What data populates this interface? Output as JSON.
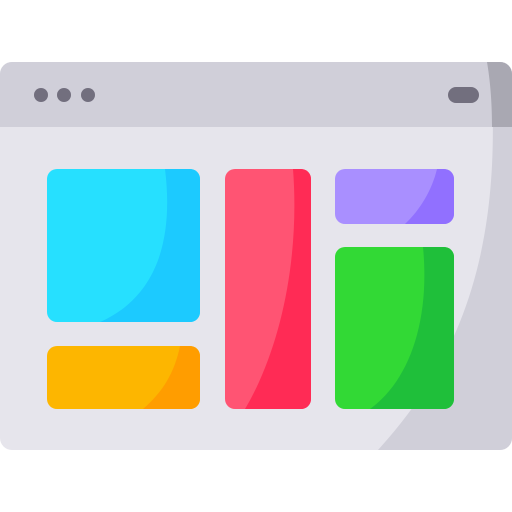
{
  "window": {
    "frame_color": "#e6e5ec",
    "frame_shade_color": "#d0cfd9",
    "titlebar_color": "#d0cfd9",
    "titlebar_shade_color": "#a9a8b2",
    "dot_color": "#726f7e",
    "dots": [
      "dot",
      "dot",
      "dot"
    ],
    "icons": [
      "window-dots-icon",
      "window-pill-icon"
    ]
  },
  "layout_blocks": [
    {
      "name": "cyan-block",
      "color": "#26e0ff",
      "shade": "#1ccaff"
    },
    {
      "name": "orange-block",
      "color": "#fdb600",
      "shade": "#ff9d00"
    },
    {
      "name": "red-block",
      "color": "#ff5473",
      "shade": "#ff2b55"
    },
    {
      "name": "purple-block",
      "color": "#a98fff",
      "shade": "#9170ff"
    },
    {
      "name": "green-block",
      "color": "#32d935",
      "shade": "#1fbf3a"
    }
  ]
}
